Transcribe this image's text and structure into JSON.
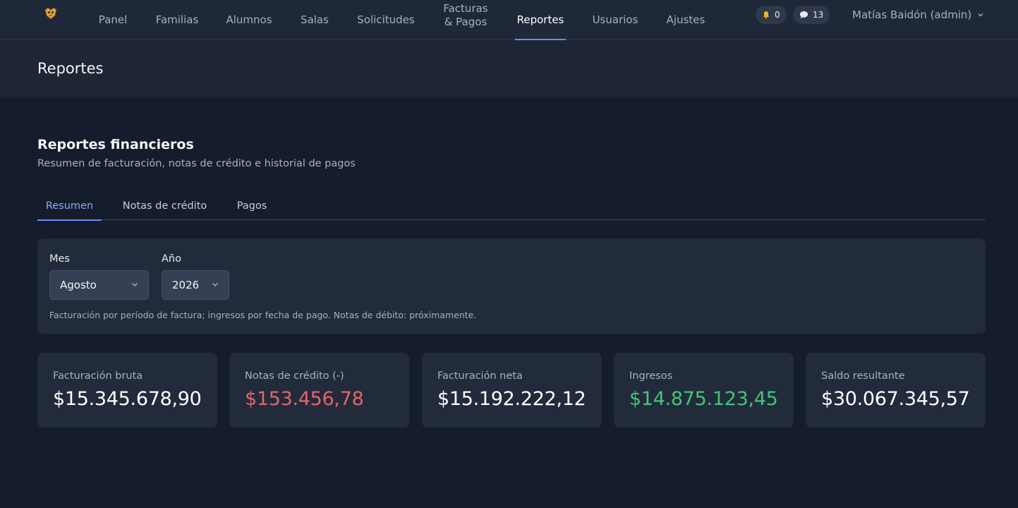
{
  "nav": {
    "items": [
      {
        "label": "Panel"
      },
      {
        "label": "Familias"
      },
      {
        "label": "Alumnos"
      },
      {
        "label": "Salas"
      },
      {
        "label": "Solicitudes"
      },
      {
        "label_line1": "Facturas",
        "label_line2": "& Pagos"
      },
      {
        "label": "Reportes",
        "active": true
      },
      {
        "label": "Usuarios"
      },
      {
        "label": "Ajustes"
      }
    ],
    "notifications_count": "0",
    "messages_count": "13",
    "user_name": "Matías Baidón (admin)",
    "accent_color": "#6b8cff"
  },
  "page": {
    "title": "Reportes"
  },
  "section": {
    "title": "Reportes financieros",
    "subtitle": "Resumen de facturación, notas de crédito e historial de pagos"
  },
  "tabs": [
    {
      "label": "Resumen",
      "active": true
    },
    {
      "label": "Notas de crédito"
    },
    {
      "label": "Pagos"
    }
  ],
  "filters": {
    "month_label": "Mes",
    "month_value": "Agosto",
    "year_label": "Año",
    "year_value": "2026",
    "note": "Facturación por período de factura; ingresos por fecha de pago. Notas de débito: próximamente."
  },
  "cards": [
    {
      "label": "Facturación bruta",
      "value": "$15.345.678,90"
    },
    {
      "label": "Notas de crédito (-)",
      "value": "$153.456,78",
      "color": "#e0666a"
    },
    {
      "label": "Facturación neta",
      "value": "$15.192.222,12"
    },
    {
      "label": "Ingresos",
      "value": "$14.875.123,45",
      "color": "#45c27a"
    },
    {
      "label": "Saldo resultante",
      "value": "$30.067.345,57"
    }
  ]
}
